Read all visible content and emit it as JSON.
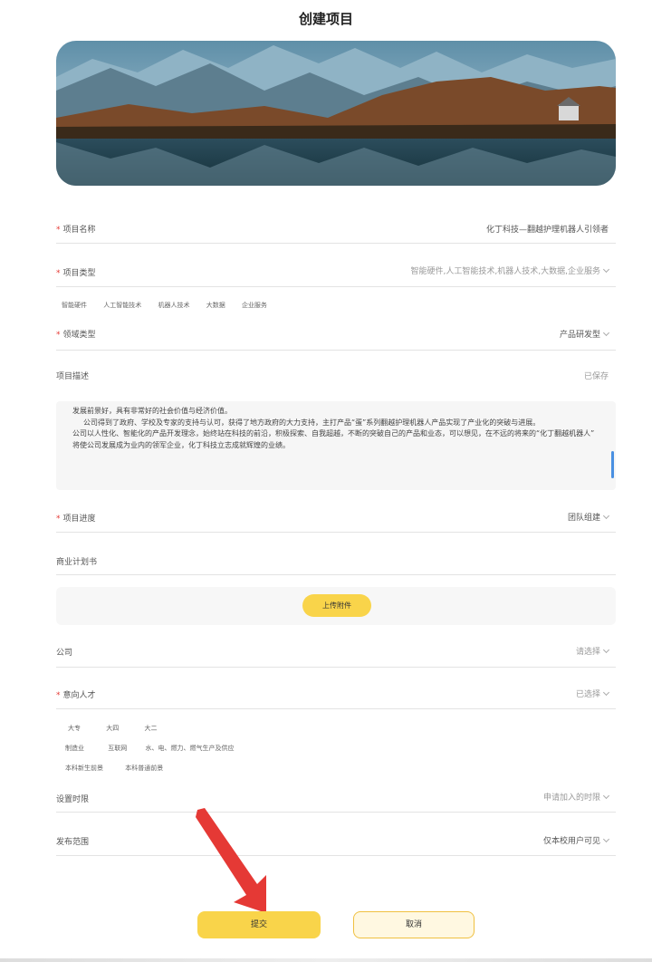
{
  "page": {
    "title": "创建项目"
  },
  "form": {
    "name": {
      "label": "项目名称",
      "value": "化丁科技—翻越护理机器人引领者"
    },
    "field": {
      "label": "项目类型",
      "value": "智能硬件,人工智能技术,机器人技术,大数据,企业服务"
    },
    "field_tags": [
      "智能硬件",
      "人工智能技术",
      "机器人技术",
      "大数据",
      "企业服务"
    ],
    "stage": {
      "label": "领域类型",
      "value": "产品研发型"
    },
    "desc": {
      "label": "项目描述",
      "status": "已保存"
    },
    "desc_text": [
      "发展前景好，具有非常好的社会价值与经济价值。",
      "公司得到了政府、学校及专家的支持与认可，获得了地方政府的大力支持，主打产品“蛋”系列翻越护理机器人产品实现了产业化的突破与进展。",
      "公司以人性化、智能化的产品开发理念，始终站在科技的前沿，积极探索、自我超越，不断的突破自己的产品和业态，可以想见，在不远的将来的“化丁翻越机器人”",
      "将使公司发展成为业内的领军企业，化丁科技立志成就辉煌的业绩。"
    ],
    "progress": {
      "label": "项目进度",
      "value": "团队组建"
    },
    "plan": {
      "label": "商业计划书"
    },
    "upload_label": "上传附件",
    "company": {
      "label": "公司",
      "value": "请选择"
    },
    "talent": {
      "label": "意向人才",
      "value": "已选择"
    },
    "talent_tags_row1": [
      "大专",
      "大四",
      "大二"
    ],
    "talent_tags_row2": [
      "制造业",
      "互联网",
      "水、电、燃力、燃气生产及供应"
    ],
    "talent_tags_row3": [
      "本科新生前景",
      "本科普通前景"
    ],
    "deadline": {
      "label": "设置时限",
      "value": "申请加入的时限"
    },
    "scope": {
      "label": "发布范围",
      "value": "仅本校用户可见"
    }
  },
  "buttons": {
    "submit": "提交",
    "cancel": "取消"
  },
  "colors": {
    "accent": "#f9d44a",
    "required": "#e53935",
    "arrow": "#e53935"
  }
}
